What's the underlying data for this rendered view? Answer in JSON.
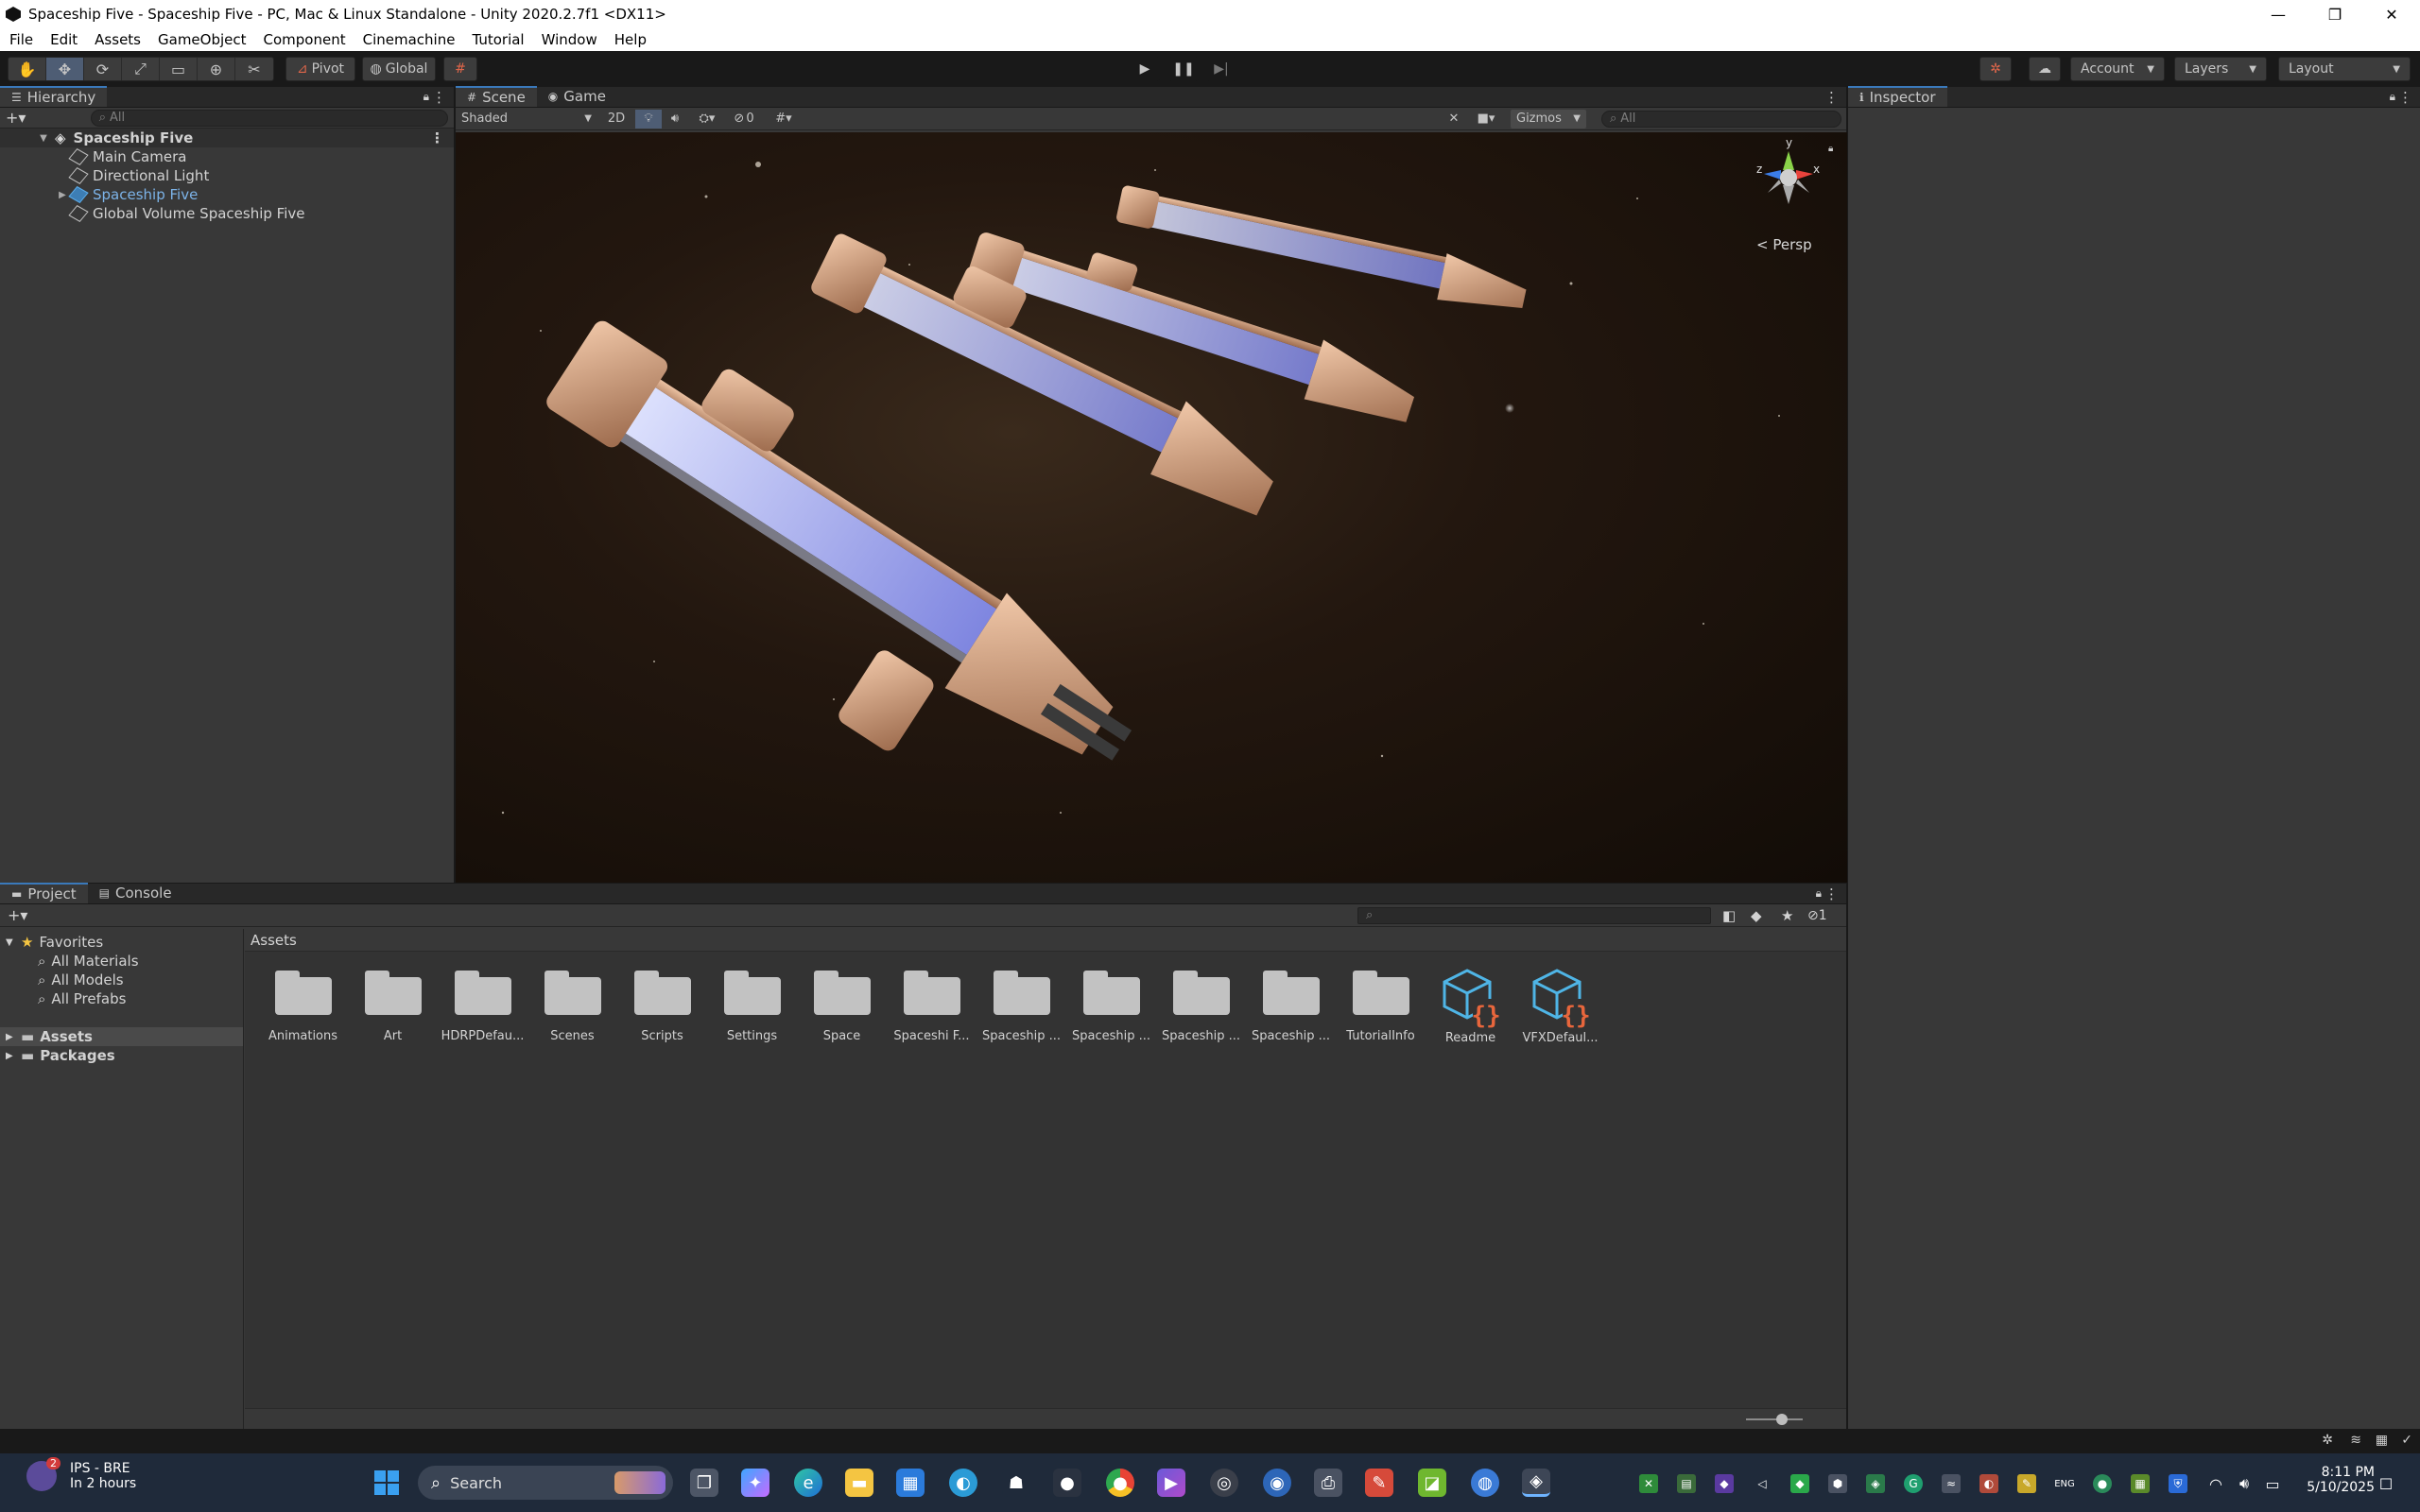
{
  "window": {
    "title": "Spaceship Five - Spaceship Five - PC, Mac & Linux Standalone - Unity 2020.2.7f1 <DX11>",
    "minimize": "—",
    "restore": "❐",
    "close": "✕"
  },
  "menu": [
    "File",
    "Edit",
    "Assets",
    "GameObject",
    "Component",
    "Cinemachine",
    "Tutorial",
    "Window",
    "Help"
  ],
  "toolbar": {
    "pivot_label": "Pivot",
    "global_label": "Global",
    "account_label": "Account",
    "layers_label": "Layers",
    "layout_label": "Layout"
  },
  "hierarchy": {
    "tab": "Hierarchy",
    "search_placeholder": "All",
    "scene_name": "Spaceship Five",
    "items": [
      "Main Camera",
      "Directional Light",
      "Spaceship Five",
      "Global Volume Spaceship Five"
    ]
  },
  "scene": {
    "tabs": [
      "Scene",
      "Game"
    ],
    "shading_mode": "Shaded",
    "two_d": "2D",
    "hidden_count": "0",
    "gizmos_label": "Gizmos",
    "search_placeholder": "All",
    "gizmo_y": "y",
    "gizmo_x": "x",
    "gizmo_z": "z",
    "persp_label": "Persp"
  },
  "inspector": {
    "tab": "Inspector"
  },
  "project": {
    "tabs": [
      "Project",
      "Console"
    ],
    "favorites_label": "Favorites",
    "favorites": [
      "All Materials",
      "All Models",
      "All Prefabs"
    ],
    "roots": [
      "Assets",
      "Packages"
    ],
    "breadcrumb": "Assets",
    "hidden_packages_count": "1",
    "assets": [
      {
        "label": "Animations",
        "type": "folder"
      },
      {
        "label": "Art",
        "type": "folder"
      },
      {
        "label": "HDRPDefau...",
        "type": "folder"
      },
      {
        "label": "Scenes",
        "type": "folder"
      },
      {
        "label": "Scripts",
        "type": "folder"
      },
      {
        "label": "Settings",
        "type": "folder"
      },
      {
        "label": "Space",
        "type": "folder"
      },
      {
        "label": "Spaceshi F...",
        "type": "folder"
      },
      {
        "label": "Spaceship ...",
        "type": "folder"
      },
      {
        "label": "Spaceship ...",
        "type": "folder"
      },
      {
        "label": "Spaceship ...",
        "type": "folder"
      },
      {
        "label": "Spaceship ...",
        "type": "folder"
      },
      {
        "label": "TutorialInfo",
        "type": "folder"
      },
      {
        "label": "Readme",
        "type": "script"
      },
      {
        "label": "VFXDefaul...",
        "type": "script"
      }
    ]
  },
  "taskbar": {
    "weather_badge": "2",
    "weather_title": "IPS - BRE",
    "weather_sub": "In 2 hours",
    "search_label": "Search",
    "time": "8:11 PM",
    "date": "5/10/2025"
  },
  "colors": {
    "accent": "#3a79bb",
    "panel": "#383838",
    "script_blue": "#4fb5e6",
    "script_orange": "#e8663c"
  }
}
